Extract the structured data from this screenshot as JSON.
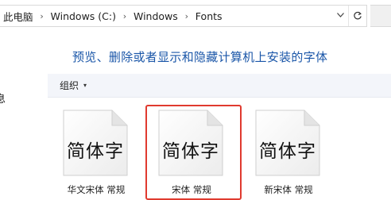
{
  "address_bar": {
    "crumbs": [
      "此电脑",
      "Windows (C:)",
      "Windows",
      "Fonts"
    ],
    "separator": "›",
    "dropdown_icon": "chevron-down-icon",
    "refresh_icon": "refresh-icon"
  },
  "nav": {
    "fragment_text": "息"
  },
  "heading": {
    "text": "预览、删除或者显示和隐藏计算机上安装的字体"
  },
  "toolbar": {
    "organize_label": "组织",
    "organize_caret": "▾"
  },
  "fonts": [
    {
      "glyphs": "简体字",
      "name": "华文宋体 常规",
      "selected": false
    },
    {
      "glyphs": "简体字",
      "name": "宋体 常规",
      "selected": true
    },
    {
      "glyphs": "简体字",
      "name": "新宋体 常规",
      "selected": false
    }
  ],
  "colors": {
    "heading_link": "#1a56a8",
    "selection_outline": "#e03a2f",
    "toolbar_bg": "#f3f5fa"
  }
}
